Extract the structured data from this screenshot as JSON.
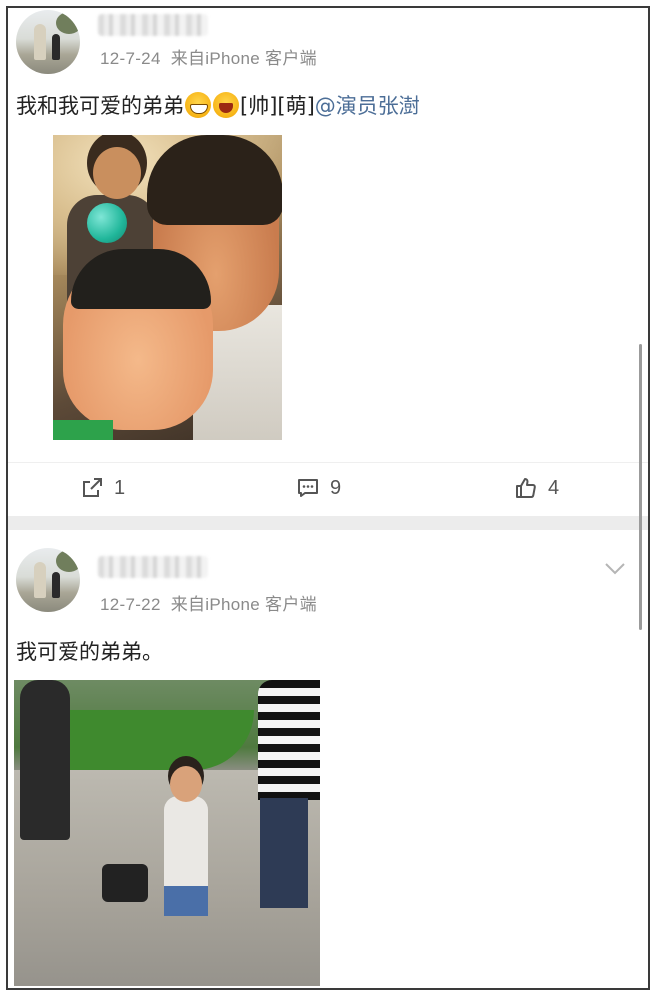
{
  "posts": [
    {
      "date": "12-7-24",
      "source": "来自iPhone 客户端",
      "text_before": "我和我可爱的弟弟",
      "emoji_1": "grin-emoji",
      "emoji_2": "laugh-emoji",
      "tags": "[帅][萌]",
      "mention": "@演员张澍",
      "actions": {
        "repost_count": "1",
        "comment_count": "9",
        "like_count": "4"
      }
    },
    {
      "date": "12-7-22",
      "source": "来自iPhone 客户端",
      "text": "我可爱的弟弟。"
    }
  ],
  "icons": {
    "repost": "share-square-icon",
    "comment": "comment-bubble-icon",
    "like": "thumbs-up-icon",
    "more": "chevron-down-icon"
  },
  "colors": {
    "mention": "#4c6e97",
    "meta": "#8a8a8a",
    "separator": "#ececec"
  }
}
